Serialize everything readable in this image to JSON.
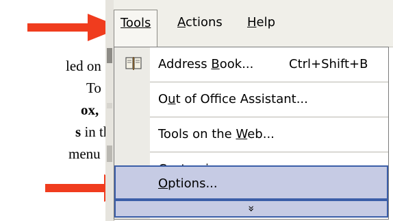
{
  "document": {
    "lines": [
      {
        "text": "led on",
        "bold": false
      },
      {
        "text": "To",
        "bold": false
      },
      {
        "text": "ox,",
        "bold": true
      },
      {
        "text": "s in the",
        "bold": true
      },
      {
        "text": "menu",
        "bold": false
      }
    ]
  },
  "menubar": {
    "items": [
      {
        "label": "Tools",
        "active": true
      },
      {
        "label": "Actions",
        "active": false
      },
      {
        "label": "Help",
        "active": false
      }
    ]
  },
  "menu": {
    "items": [
      {
        "label": "Address Book...",
        "shortcut": "Ctrl+Shift+B",
        "icon": "address-book-icon"
      },
      {
        "label": "Out of Office Assistant..."
      },
      {
        "label": "Tools on the Web..."
      },
      {
        "label": "Customize..."
      },
      {
        "label": "Options...",
        "highlighted": true
      }
    ],
    "expand_glyph": "¥"
  },
  "colors": {
    "arrow": "#f03c1e",
    "highlight_fill": "#c6cbe4",
    "highlight_border": "#3b5ea8"
  }
}
